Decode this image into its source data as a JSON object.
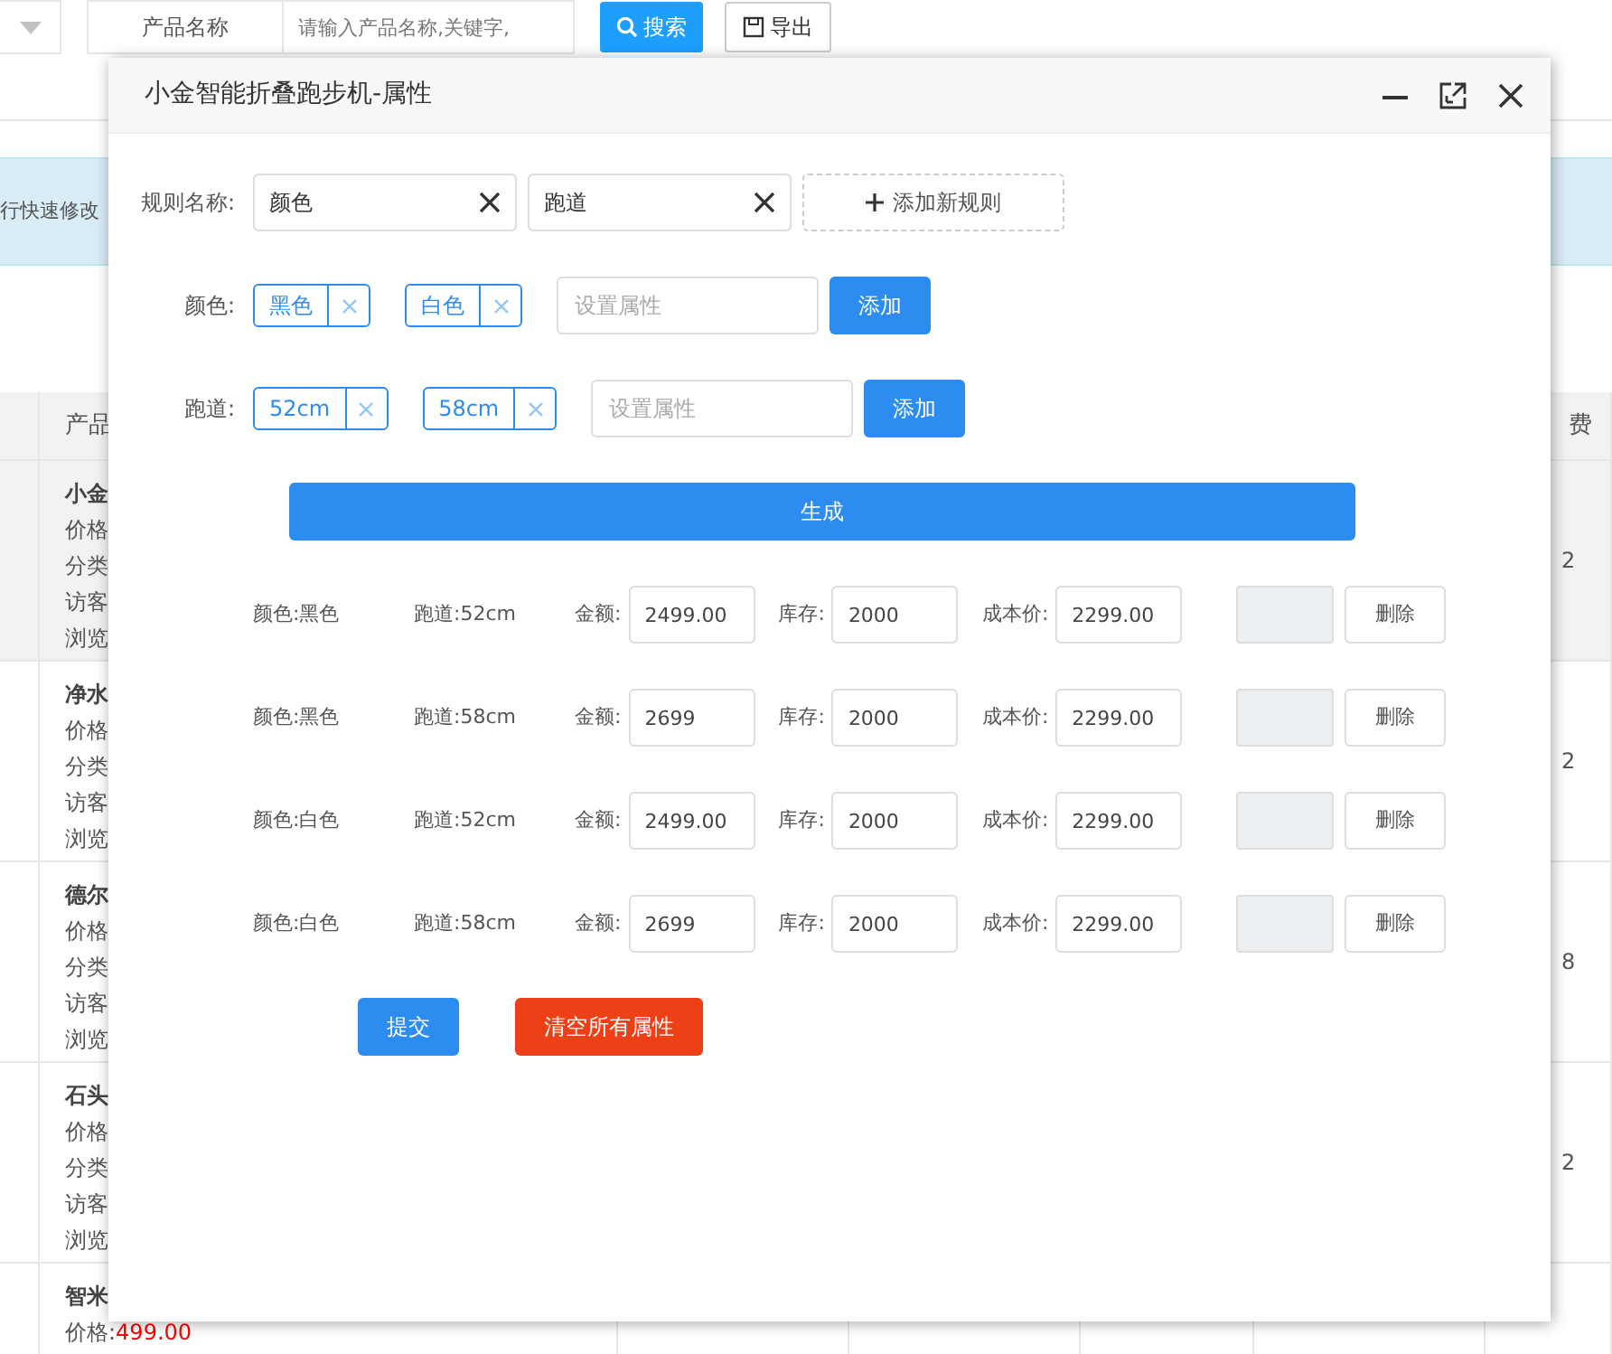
{
  "toolbar": {
    "search_group": {
      "label": "产品名称",
      "placeholder": "请输入产品名称,关键字,"
    },
    "buttons": [
      {
        "label": "搜索",
        "kind": "search"
      },
      {
        "label": "导出",
        "kind": "export"
      }
    ]
  },
  "notice": "行快速修改",
  "table": {
    "columns": [
      "产品",
      "费"
    ],
    "rows": [
      {
        "title": "小金",
        "lines": [
          {
            "label": "价格"
          },
          {
            "label": "分类"
          },
          {
            "label": "访客"
          },
          {
            "label": "浏览"
          }
        ],
        "column_2": "2",
        "highlighted": true
      },
      {
        "title": "净水",
        "lines": [
          {
            "label": "价格"
          },
          {
            "label": "分类"
          },
          {
            "label": "访客"
          },
          {
            "label": "浏览"
          }
        ],
        "column_2": "2",
        "highlighted": false
      },
      {
        "title": "德尔",
        "lines": [
          {
            "label": "价格"
          },
          {
            "label": "分类"
          },
          {
            "label": "访客"
          },
          {
            "label": "浏览"
          }
        ],
        "column_2": "8",
        "highlighted": false
      },
      {
        "title": "石头",
        "lines": [
          {
            "label": "价格"
          },
          {
            "label": "分类"
          },
          {
            "label": "访客"
          },
          {
            "label": "浏览"
          }
        ],
        "column_2": "2",
        "highlighted": false
      },
      {
        "title": "智米",
        "lines": [
          {
            "label": "价格:",
            "value": "499.00"
          }
        ],
        "highlighted": false
      }
    ]
  },
  "modal": {
    "title": "小金智能折叠跑步机-属性",
    "rule_label": "规则名称:",
    "rules": [
      {
        "name": "颜色"
      },
      {
        "name": "跑道"
      }
    ],
    "add_rule_button": "添加新规则",
    "attributes": [
      {
        "label": "颜色:",
        "values": [
          "黑色",
          "白色"
        ],
        "placeholder": "设置属性",
        "add_button": "添加"
      },
      {
        "label": "跑道:",
        "values": [
          "52cm",
          "58cm"
        ],
        "placeholder": "设置属性",
        "add_button": "添加"
      }
    ],
    "generate_button": "生成",
    "combinations": [
      {
        "spec_1": "颜色:黑色",
        "spec_2": "跑道:52cm",
        "amount_label": "金额:",
        "amount": "2499.00",
        "stock_label": "库存:",
        "stock": "2000",
        "cost_label": "成本价:",
        "cost": "2299.00",
        "delete_button": "删除"
      },
      {
        "spec_1": "颜色:黑色",
        "spec_2": "跑道:58cm",
        "amount_label": "金额:",
        "amount": "2699",
        "stock_label": "库存:",
        "stock": "2000",
        "cost_label": "成本价:",
        "cost": "2299.00",
        "delete_button": "删除"
      },
      {
        "spec_1": "颜色:白色",
        "spec_2": "跑道:52cm",
        "amount_label": "金额:",
        "amount": "2499.00",
        "stock_label": "库存:",
        "stock": "2000",
        "cost_label": "成本价:",
        "cost": "2299.00",
        "delete_button": "删除"
      },
      {
        "spec_1": "颜色:白色",
        "spec_2": "跑道:58cm",
        "amount_label": "金额:",
        "amount": "2699",
        "stock_label": "库存:",
        "stock": "2000",
        "cost_label": "成本价:",
        "cost": "2299.00",
        "delete_button": "删除"
      }
    ],
    "submit_button": "提交",
    "clear_button": "清空所有属性"
  }
}
